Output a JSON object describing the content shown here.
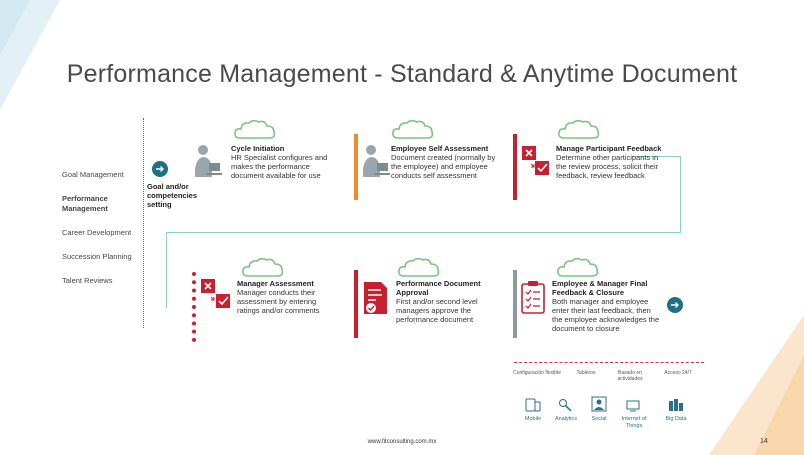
{
  "slide": {
    "title": "Performance Management - Standard & Anytime Document",
    "footer_url": "www.fitconsulting.com.mx",
    "page_number": "14"
  },
  "sidebar": {
    "items": [
      {
        "label": "Goal Management",
        "active": false
      },
      {
        "label": "Performance Management",
        "active": true
      },
      {
        "label": "Career Development",
        "active": false
      },
      {
        "label": "Succession Planning",
        "active": false
      },
      {
        "label": "Talent Reviews",
        "active": false
      }
    ]
  },
  "flow": {
    "start_label": "Goal and/or competencies setting",
    "steps": [
      {
        "title": "Cycle Initiation",
        "desc": "HR Specialist configures and makes the performance document available for use",
        "icon": "person-computer-icon"
      },
      {
        "title": "Employee Self Assessment",
        "desc": "Document created (normally by the employee) and employee conducts self assessment",
        "icon": "person-computer-icon"
      },
      {
        "title": "Manage Participant Feedback",
        "desc": "Determine other participants in the review process, solicit their feedback, review feedback",
        "icon": "review-icon"
      },
      {
        "title": "Manager Assessment",
        "desc": "Manager conducts their assessment by entering ratings and/or comments",
        "icon": "review-icon"
      },
      {
        "title": "Performance Document Approval",
        "desc": "First and/or second level managers approve the performance document",
        "icon": "document-approve-icon"
      },
      {
        "title": "Employee & Manager Final Feedback & Closure",
        "desc": "Both manager and employee enter their last feedback, then the employee acknowledges the document to closure",
        "icon": "clipboard-checklist-icon"
      }
    ]
  },
  "features": {
    "top": [
      "Configuración flexible",
      "Tableros",
      "Basado en actividades",
      "Acceso 24/7"
    ],
    "tech": [
      "Mobile",
      "Analytics",
      "Social",
      "Internet of Things",
      "Big Data"
    ]
  },
  "colors": {
    "accent_red": "#c8202f",
    "accent_orange": "#f28c28",
    "accent_gray": "#8f9aa0",
    "teal": "#1f6f8b",
    "flow_line": "#8ccfcf",
    "cloud": "#7bc47f"
  }
}
